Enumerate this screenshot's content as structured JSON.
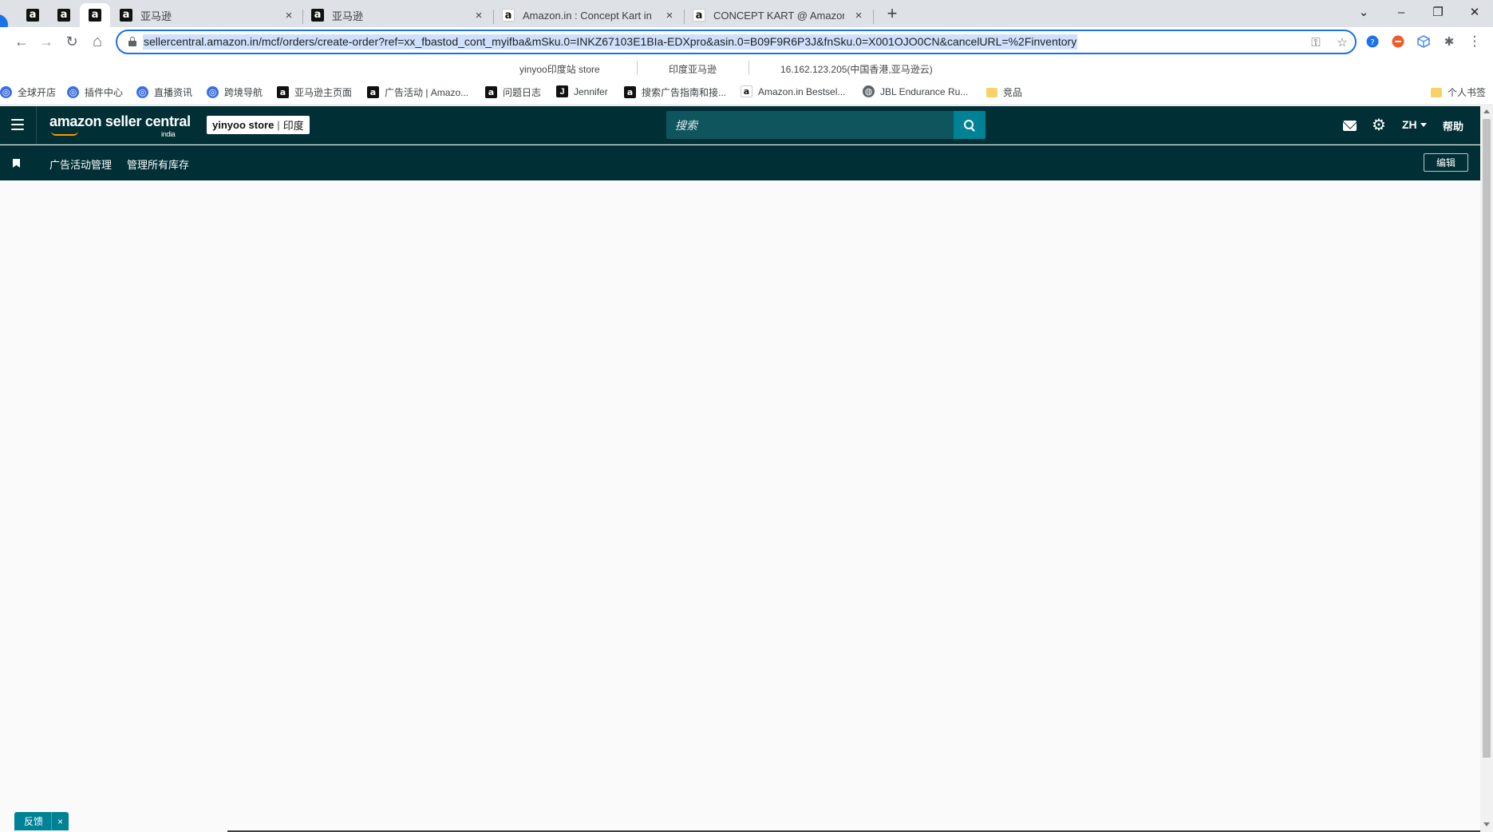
{
  "browser": {
    "pinned_tabs": [
      {
        "favicon": "a"
      },
      {
        "favicon": "a"
      },
      {
        "favicon": "a"
      }
    ],
    "tabs": [
      {
        "favicon": "a",
        "title": "亚马逊",
        "close": "×"
      },
      {
        "favicon": "a",
        "title": "亚马逊",
        "close": "×"
      },
      {
        "favicon": "a",
        "title": "Amazon.in : Concept Kart in E",
        "close": "×"
      },
      {
        "favicon": "a",
        "title": "CONCEPT KART @ Amazon.in:",
        "close": "×"
      }
    ],
    "new_tab": "+",
    "window_controls": {
      "tab_search": "⌄",
      "minimize": "–",
      "restore": "❐",
      "close": "✕"
    },
    "nav": {
      "back": "←",
      "forward": "→",
      "reload": "↻",
      "home": "⌂"
    },
    "url": "sellercentral.amazon.in/mcf/orders/create-order?ref=xx_fbastod_cont_myifba&mSku.0=INKZ67103E1BIa-EDXpro&asin.0=B09F9R6P3J&fnSku.0=X001OJO0CN&cancelURL=%2Finventory",
    "omnibox_icons": {
      "key": "⚿",
      "star": "☆"
    },
    "extensions": {
      "puzzle": "✱",
      "menu": "⋮"
    },
    "infobar": {
      "store": "yinyoo印度站 store",
      "marketplace": "印度亚马逊",
      "ip": "16.162.123.205(中国香港,亚马逊云)"
    },
    "bookmarks": [
      {
        "icon": "globe-icon",
        "label": "全球开店"
      },
      {
        "icon": "globe-icon",
        "label": "插件中心"
      },
      {
        "icon": "globe-icon",
        "label": "直播资讯"
      },
      {
        "icon": "globe-icon",
        "label": "跨境导航"
      },
      {
        "icon": "amazon-icon",
        "label": "亚马逊主页面"
      },
      {
        "icon": "amazon-icon",
        "label": "广告活动 | Amazo..."
      },
      {
        "icon": "amazon-icon",
        "label": "问题日志"
      },
      {
        "icon": "j-icon",
        "label": "Jennifer"
      },
      {
        "icon": "amazon-icon",
        "label": "搜索广告指南和接..."
      },
      {
        "icon": "amazon-light-icon",
        "label": "Amazon.in Bestsel..."
      },
      {
        "icon": "globe-icon",
        "label": "JBL Endurance Ru..."
      },
      {
        "icon": "folder-icon",
        "label": "竞品"
      }
    ],
    "other_bookmarks": "个人书签"
  },
  "seller_central": {
    "logo_text": "amazon seller central",
    "logo_region": "india",
    "store_name": "yinyoo store",
    "store_region": "印度",
    "search_placeholder": "搜索",
    "language": "ZH",
    "help": "帮助",
    "bookmark_links": [
      "广告活动管理",
      "管理所有库存"
    ],
    "edit": "编辑",
    "feedback": "反馈",
    "feedback_close": "×"
  },
  "colors": {
    "header_bg": "#002f36",
    "search_bg": "#0f555e",
    "accent": "#008296",
    "url_highlight": "#cfe0fc"
  }
}
